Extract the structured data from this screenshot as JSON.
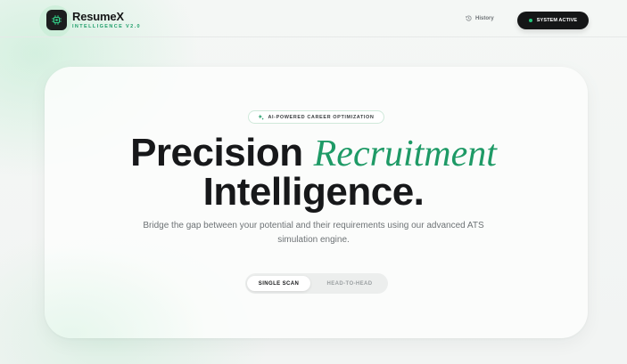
{
  "header": {
    "brand_name": "ResumeX",
    "brand_subtitle": "INTELLIGENCE V2.0",
    "logo_icon": "circuit-icon",
    "history_label": "History",
    "history_icon": "history-icon",
    "status_label": "SYSTEM ACTIVE",
    "status_color": "#22c57a"
  },
  "hero": {
    "badge_label": "AI-POWERED CAREER OPTIMIZATION",
    "badge_icon": "sparkles-icon",
    "headline_bold": "Precision",
    "headline_italic": "Recruitment",
    "headline_line2": "Intelligence.",
    "subtitle": "Bridge the gap between your potential and their requirements using our advanced ATS simulation engine."
  },
  "tabs": [
    {
      "label": "SINGLE SCAN",
      "active": true
    },
    {
      "label": "HEAD-TO-HEAD",
      "active": false
    }
  ],
  "colors": {
    "accent": "#1e9a66",
    "dark": "#151617",
    "muted": "#6e7376"
  }
}
